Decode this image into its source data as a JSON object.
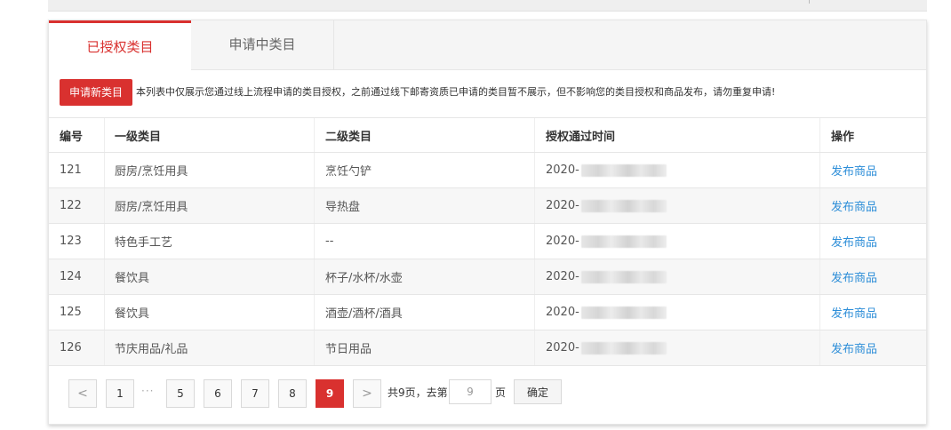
{
  "tabs": [
    {
      "label": "已授权类目",
      "active": true
    },
    {
      "label": "申请中类目",
      "active": false
    }
  ],
  "notice": {
    "button_label": "申请新类目",
    "text": "本列表中仅展示您通过线上流程申请的类目授权，之前通过线下邮寄资质已申请的类目暂不展示，但不影响您的类目授权和商品发布，请勿重复申请!"
  },
  "table": {
    "headers": [
      "编号",
      "一级类目",
      "二级类目",
      "授权通过时间",
      "操作"
    ],
    "rows": [
      {
        "id": "121",
        "cat1": "厨房/烹饪用具",
        "cat2": "烹饪勺铲",
        "time": "2020-",
        "action": "发布商品"
      },
      {
        "id": "122",
        "cat1": "厨房/烹饪用具",
        "cat2": "导热盘",
        "time": "2020-",
        "action": "发布商品"
      },
      {
        "id": "123",
        "cat1": "特色手工艺",
        "cat2": "--",
        "time": "2020-",
        "action": "发布商品"
      },
      {
        "id": "124",
        "cat1": "餐饮具",
        "cat2": "杯子/水杯/水壶",
        "time": "2020-",
        "action": "发布商品"
      },
      {
        "id": "125",
        "cat1": "餐饮具",
        "cat2": "酒壶/酒杯/酒具",
        "time": "2020-",
        "action": "发布商品"
      },
      {
        "id": "126",
        "cat1": "节庆用品/礼品",
        "cat2": "节日用品",
        "time": "2020-",
        "action": "发布商品"
      }
    ]
  },
  "pagination": {
    "prev_icon": "chevron-left-icon",
    "next_icon": "chevron-right-icon",
    "prev_glyph": "<",
    "next_glyph": ">",
    "first": "1",
    "ellipsis": "···",
    "pages": [
      "5",
      "6",
      "7",
      "8"
    ],
    "current": "9",
    "total_text": "共9页，去第",
    "input_value": "9",
    "page_suffix": "页",
    "confirm_label": "确定"
  },
  "colors": {
    "accent": "#d9312f",
    "link": "#2d8ed8"
  }
}
